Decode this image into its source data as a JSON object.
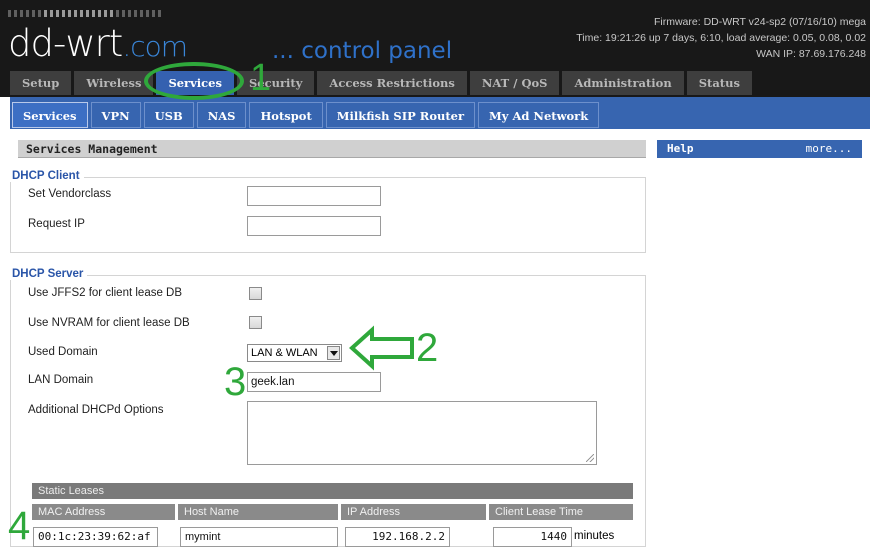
{
  "header": {
    "logo_main": "dd-wrt",
    "logo_suffix": ".com",
    "control_panel": "control panel",
    "ellipsis": "...",
    "firmware": "Firmware: DD-WRT v24-sp2 (07/16/10) mega",
    "uptime": "Time: 19:21:26 up 7 days, 6:10, load average: 0.05, 0.08, 0.02",
    "wan_ip": "WAN IP: 87.69.176.248"
  },
  "main_tabs": [
    {
      "label": "Setup",
      "active": false
    },
    {
      "label": "Wireless",
      "active": false
    },
    {
      "label": "Services",
      "active": true
    },
    {
      "label": "Security",
      "active": false
    },
    {
      "label": "Access Restrictions",
      "active": false
    },
    {
      "label": "NAT / QoS",
      "active": false
    },
    {
      "label": "Administration",
      "active": false
    },
    {
      "label": "Status",
      "active": false
    }
  ],
  "sub_tabs": [
    {
      "label": "Services",
      "active": true
    },
    {
      "label": "VPN",
      "active": false
    },
    {
      "label": "USB",
      "active": false
    },
    {
      "label": "NAS",
      "active": false
    },
    {
      "label": "Hotspot",
      "active": false
    },
    {
      "label": "Milkfish SIP Router",
      "active": false
    },
    {
      "label": "My Ad Network",
      "active": false
    }
  ],
  "section_title": "Services Management",
  "help": {
    "title": "Help",
    "more": "more..."
  },
  "dhcp_client": {
    "legend": "DHCP Client",
    "vendorclass_label": "Set Vendorclass",
    "vendorclass_value": "",
    "request_ip_label": "Request IP",
    "request_ip_value": ""
  },
  "dhcp_server": {
    "legend": "DHCP Server",
    "jffs2_label": "Use JFFS2 for client lease DB",
    "nvram_label": "Use NVRAM for client lease DB",
    "used_domain_label": "Used Domain",
    "used_domain_value": "LAN & WLAN",
    "lan_domain_label": "LAN Domain",
    "lan_domain_value": "geek.lan",
    "dhcpd_options_label": "Additional DHCPd Options"
  },
  "static_leases": {
    "title": "Static Leases",
    "headers": [
      "MAC Address",
      "Host Name",
      "IP Address",
      "Client Lease Time"
    ],
    "row": {
      "mac": "00:1c:23:39:62:af",
      "host": "mymint",
      "ip": "192.168.2.2",
      "lease": "1440",
      "unit": "minutes"
    }
  },
  "annotations": [
    "1",
    "2",
    "3",
    "4"
  ],
  "colors": {
    "accent": "#3765b0",
    "annotation": "#2fa83b",
    "header_bg": "#181818"
  }
}
